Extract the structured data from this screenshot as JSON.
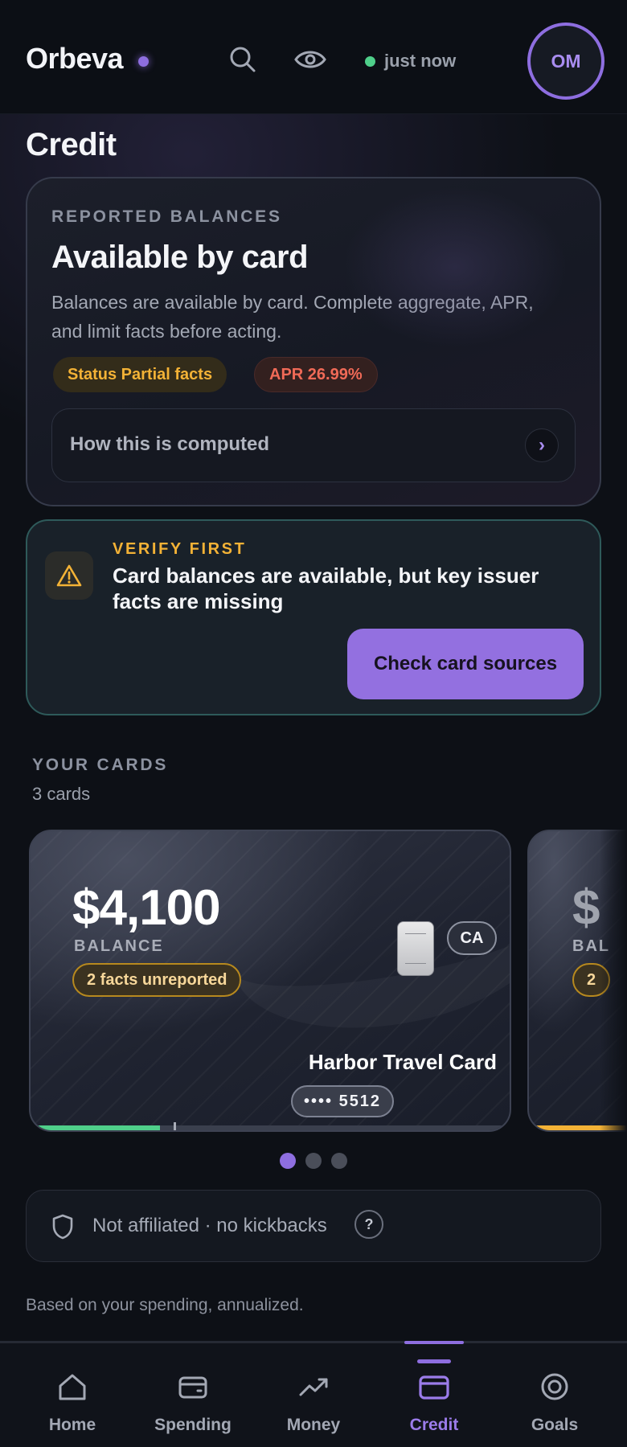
{
  "header": {
    "brand": "Orbeva",
    "sync_status": "just now",
    "avatar_initials": "OM",
    "icons": [
      "search-icon",
      "eye-icon"
    ]
  },
  "page": {
    "title": "Credit"
  },
  "balances_card": {
    "eyebrow": "REPORTED BALANCES",
    "heading": "Available by card",
    "description": "Balances are available by card. Complete aggregate, APR, and limit facts before acting.",
    "status_pill": "Status Partial facts",
    "apr_pill": "APR 26.99%",
    "computed_label": "How this is computed",
    "computed_chevron": "›"
  },
  "verify": {
    "eyebrow": "VERIFY FIRST",
    "text": "Card balances are available, but key issuer facts are missing",
    "button": "Check card sources"
  },
  "cards_section": {
    "eyebrow": "YOUR CARDS",
    "count": "3 cards",
    "cards": [
      {
        "amount": "$4,100",
        "balance_label": "BALANCE",
        "badge": "2 facts unreported",
        "region": "CA",
        "name": "Harbor Travel Card",
        "digits": "•••• 5512",
        "progress": 0.27,
        "progress_color": "#4fcf8a"
      },
      {
        "amount": "$",
        "balance_label": "BAL",
        "badge": "2",
        "progress_color": "#f3b236"
      }
    ],
    "pager": {
      "total": 3,
      "active": 0
    }
  },
  "affiliation": {
    "text": "Not affiliated · no kickbacks",
    "help": "?"
  },
  "footnote": "Based on your spending, annualized.",
  "nav": {
    "items": [
      {
        "label": "Home",
        "icon": "home-icon"
      },
      {
        "label": "Spending",
        "icon": "wallet-icon"
      },
      {
        "label": "Money",
        "icon": "trend-icon"
      },
      {
        "label": "Credit",
        "icon": "credit-card-icon",
        "active": true
      },
      {
        "label": "Goals",
        "icon": "target-icon"
      }
    ]
  },
  "colors": {
    "accent": "#8e6ee0",
    "success": "#4fcf8a",
    "warning": "#f3b236",
    "danger": "#f06a57",
    "background": "#0d1016"
  }
}
